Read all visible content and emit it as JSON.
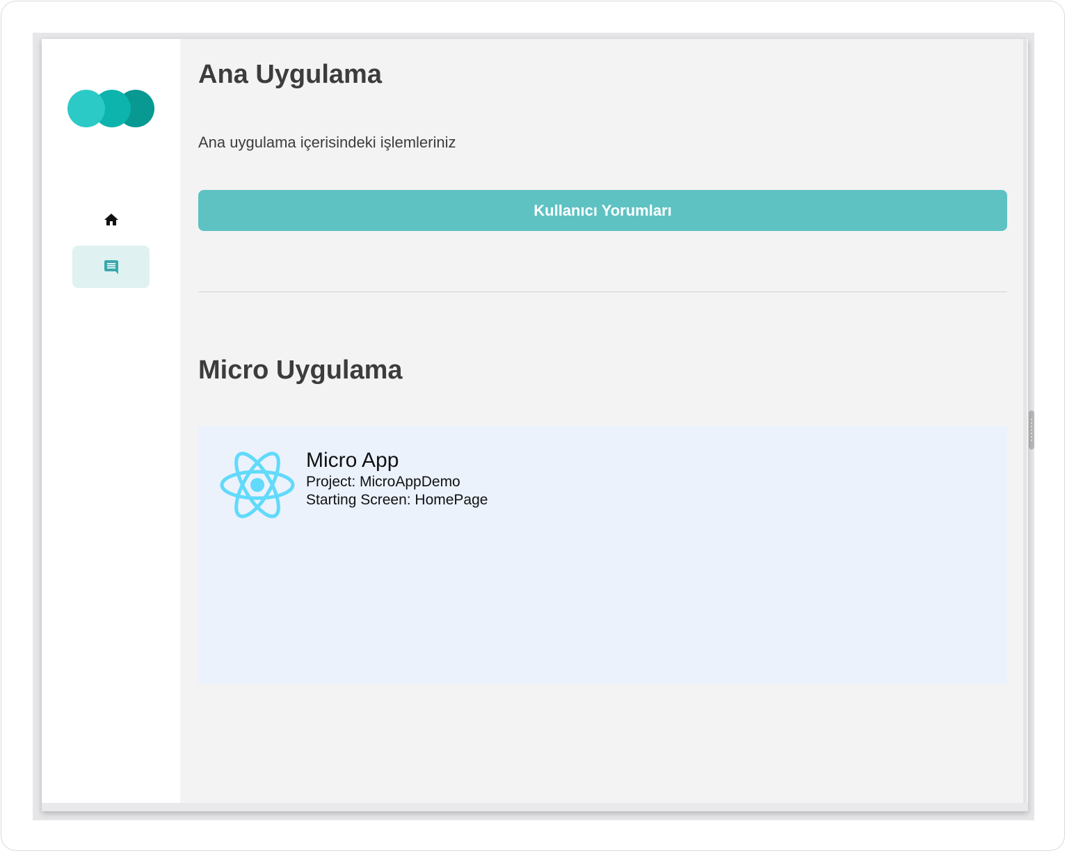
{
  "sidebar": {
    "logo": "app-logo",
    "nav": [
      {
        "icon": "home-icon",
        "active": false
      },
      {
        "icon": "comment-icon",
        "active": true
      }
    ]
  },
  "main": {
    "title": "Ana Uygulama",
    "subtitle": "Ana uygulama içerisindeki işlemleriniz",
    "button_label": "Kullanıcı Yorumları",
    "section_title": "Micro Uygulama",
    "micro_app": {
      "icon": "react-icon",
      "name": "Micro App",
      "project": "Project: MicroAppDemo",
      "starting_screen": "Starting Screen: HomePage"
    }
  },
  "colors": {
    "accent": "#5ec2c3",
    "accent_light": "#dff2f1",
    "panel_bg": "#ebf2fc",
    "react_blue": "#61dafb",
    "text": "#3c3c3c"
  }
}
